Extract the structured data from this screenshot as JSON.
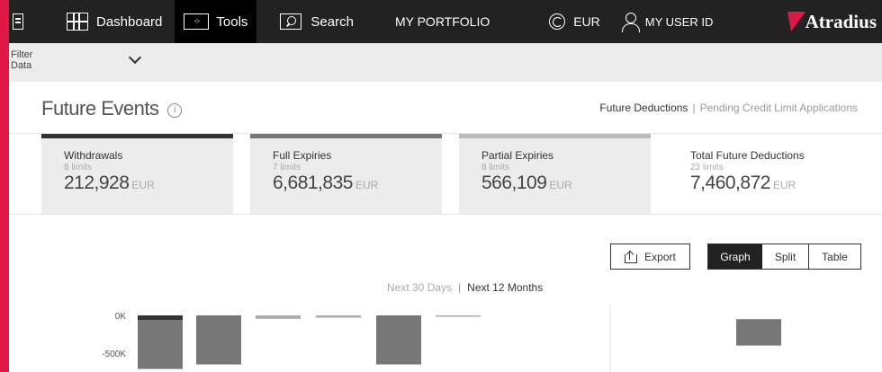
{
  "topbar": {
    "dashboard": "Dashboard",
    "tools": "Tools",
    "tools_icon_text": "-:-",
    "search": "Search",
    "portfolio": "MY PORTFOLIO",
    "currency": "EUR",
    "user": "MY USER ID",
    "logo": "Atradius"
  },
  "filter": {
    "label": "Filter Data"
  },
  "page": {
    "title": "Future Events",
    "info": "i",
    "link_active": "Future Deductions",
    "link_separator": "|",
    "link_inactive": "Pending Credit Limit Applications"
  },
  "cards": [
    {
      "name": "Withdrawals",
      "sub": "8 limits",
      "value": "212,928",
      "currency": "EUR"
    },
    {
      "name": "Full Expiries",
      "sub": "7 limits",
      "value": "6,681,835",
      "currency": "EUR"
    },
    {
      "name": "Partial Expiries",
      "sub": "8 limits",
      "value": "566,109",
      "currency": "EUR"
    },
    {
      "name": "Total Future Deductions",
      "sub": "23 limits",
      "value": "7,460,872",
      "currency": "EUR"
    }
  ],
  "actions": {
    "export": "Export",
    "graph": "Graph",
    "split": "Split",
    "table": "Table"
  },
  "range": {
    "days": "Next 30 Days",
    "separator": "|",
    "months": "Next 12 Months"
  },
  "chart_data": {
    "type": "bar",
    "y_ticks": [
      "0K",
      "-500K"
    ],
    "ylim_visible": [
      -650000,
      0
    ],
    "colors": {
      "withdrawals": "#333333",
      "full_expiries": "#777777",
      "partial_expiries": "#aaaaaa"
    },
    "bars": [
      {
        "withdrawals": -60000,
        "full_expiries": -650000
      },
      {
        "withdrawals": 0,
        "full_expiries": -650000
      },
      {
        "withdrawals": 0,
        "partial_expiries": -45000
      },
      {
        "withdrawals": 0,
        "partial_expiries": -30000
      },
      {
        "withdrawals": 0,
        "full_expiries": -650000
      },
      {
        "withdrawals": 0,
        "partial_expiries": -6000
      }
    ],
    "split_bar": {
      "full_expiries_from": -50000,
      "full_expiries_to": -400000
    }
  }
}
